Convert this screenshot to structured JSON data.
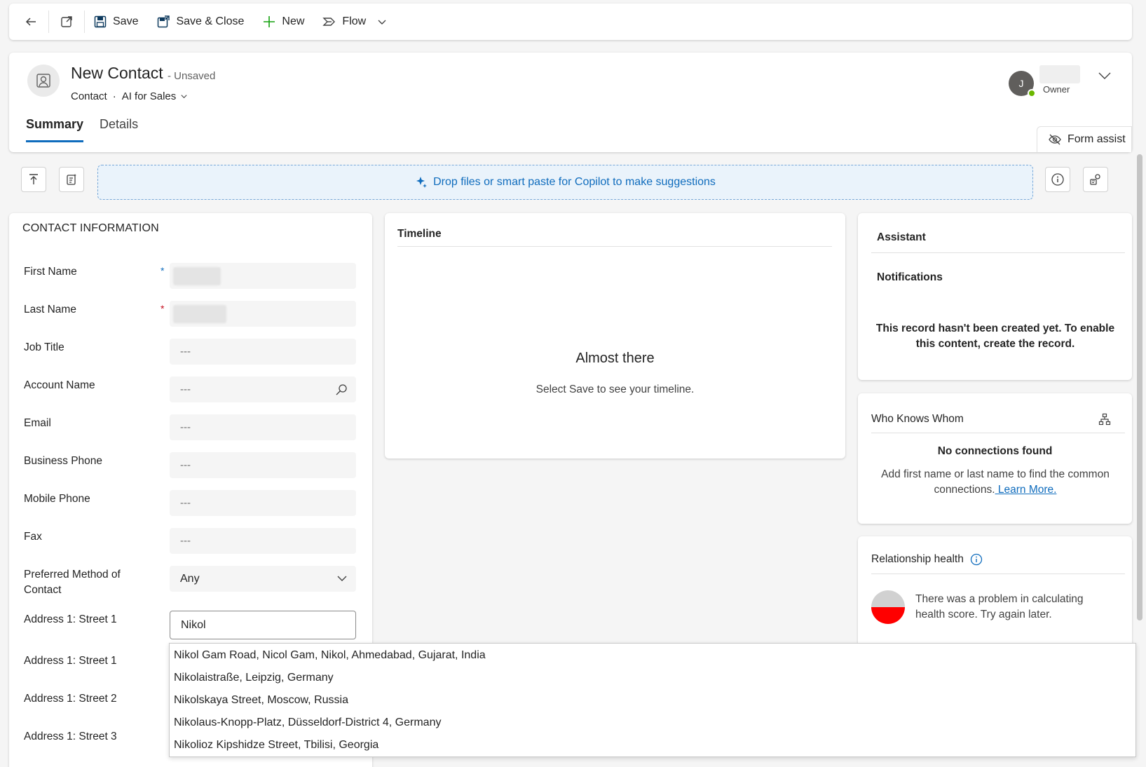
{
  "command_bar": {
    "save": "Save",
    "save_close": "Save & Close",
    "new": "New",
    "flow": "Flow"
  },
  "header": {
    "title": "New Contact",
    "state": "- Unsaved",
    "entity": "Contact",
    "separator": "·",
    "form_name": "AI for Sales",
    "owner_initial": "J",
    "owner_label": "Owner",
    "tabs": [
      {
        "label": "Summary",
        "active": true
      },
      {
        "label": "Details",
        "active": false
      }
    ],
    "form_assist": "Form assist"
  },
  "copilot_drop": {
    "text": "Drop files or smart paste for Copilot to make suggestions",
    "accent_color": "#0f6cbd"
  },
  "contact_info": {
    "section_title": "CONTACT INFORMATION",
    "fields": [
      {
        "label": "First Name",
        "value": "",
        "required": "*"
      },
      {
        "label": "Last Name",
        "value": "",
        "required": "*"
      },
      {
        "label": "Job Title",
        "value": "---"
      },
      {
        "label": "Account Name",
        "value": "---"
      },
      {
        "label": "Email",
        "value": "---"
      },
      {
        "label": "Business Phone",
        "value": "---"
      },
      {
        "label": "Mobile Phone",
        "value": "---"
      },
      {
        "label": "Fax",
        "value": "---"
      },
      {
        "label": "Preferred Method of Contact",
        "value": "Any"
      },
      {
        "label": "Address 1: Street 1",
        "value": "Nikol"
      },
      {
        "label": "Address 1: Street 1",
        "value": ""
      },
      {
        "label": "Address 1: Street 2",
        "value": ""
      },
      {
        "label": "Address 1: Street 3",
        "value": ""
      }
    ]
  },
  "timeline": {
    "title": "Timeline",
    "empty_title": "Almost there",
    "empty_text": "Select Save to see your timeline."
  },
  "assistant": {
    "title": "Assistant",
    "notifications": "Notifications",
    "message": "This record hasn't been created yet. To enable this content, create the record."
  },
  "who_knows_whom": {
    "title": "Who Knows Whom",
    "empty_title": "No connections found",
    "message": "Add first name or last name to find the common connections.",
    "link": " Learn More."
  },
  "relationship_health": {
    "title": "Relationship health",
    "message": "There was a problem in calculating health score. Try again later."
  },
  "address_suggestions": [
    "Nikol Gam Road, Nicol Gam, Nikol, Ahmedabad, Gujarat, India",
    "Nikolaistraße, Leipzig, Germany",
    "Nikolskaya Street, Moscow, Russia",
    "Nikolaus-Knopp-Platz, Düsseldorf-District 4, Germany",
    "Nikolioz Kipshidze Street, Tbilisi, Georgia"
  ]
}
